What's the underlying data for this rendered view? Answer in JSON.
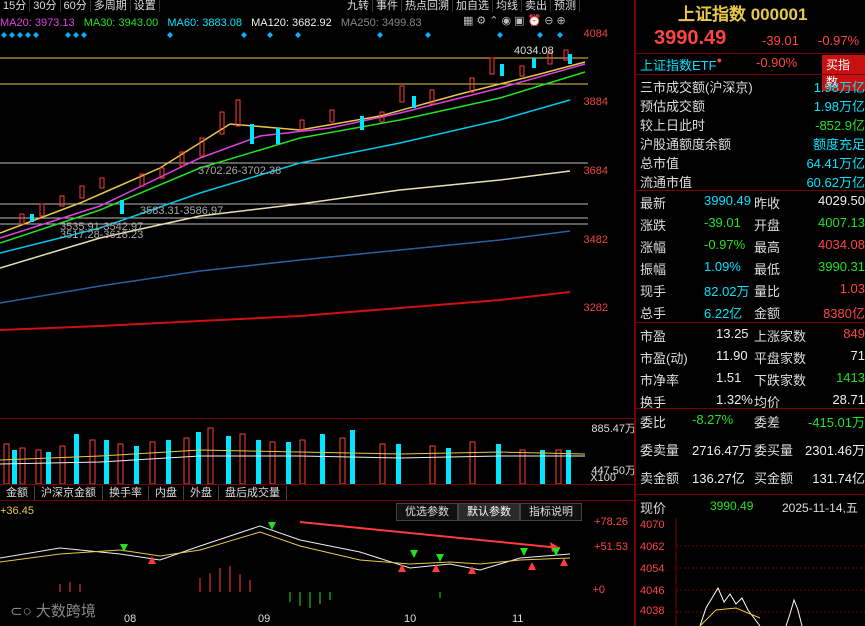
{
  "toolbar": {
    "items": [
      "15分",
      "30分",
      "60分",
      "多周期",
      "设置"
    ],
    "right_items": [
      "九转",
      "事件",
      "热点回溯",
      "加自选",
      "均线",
      "卖出",
      "预测"
    ]
  },
  "ma": {
    "ma20": "MA20: 3973.13",
    "ma30": "MA30: 3943.00",
    "ma60": "MA60: 3883.08",
    "ma120": "MA120: 3682.92",
    "ma250": "MA250: 3499.83"
  },
  "price_axis": [
    "4084",
    "3884",
    "3684",
    "3482",
    "3282"
  ],
  "price_annotations": {
    "high": "4034.08",
    "a1": "3702.26-3702.38",
    "a2": "3583.31-3586.97",
    "a3": "3535.91-3542.97",
    "a4": "3517.28-3618.23"
  },
  "volume_axis": {
    "top": "885.47万",
    "mid": "447.50万",
    "unit": "X100"
  },
  "bottom_tabs": [
    "金额",
    "沪深京金额",
    "换手率",
    "内盘",
    "外盘",
    "盘后成交量"
  ],
  "indicator": {
    "value": "+36.45",
    "tabs": [
      "优选参数",
      "默认参数",
      "指标说明"
    ],
    "axis": [
      "+78.26",
      "+51.53",
      "+0"
    ]
  },
  "x_axis": [
    "08",
    "09",
    "10",
    "11"
  ],
  "watermark": "大数跨境",
  "right": {
    "title": "上证指数 000001",
    "price": "3990.49",
    "change": "-39.01",
    "change_pct": "-0.97%",
    "etf_label": "上证指数ETF",
    "etf_pct": "-0.90%",
    "buy_btn": "买指数",
    "info": [
      {
        "k": "三市成交额(沪深京)",
        "v": "1.98万亿"
      },
      {
        "k": "预估成交额",
        "v": "1.98万亿"
      },
      {
        "k": "较上日此时",
        "v": "-852.9亿"
      },
      {
        "k": "沪股通额度余额",
        "v": "额度充足"
      },
      {
        "k": "总市值",
        "v": "64.41万亿"
      },
      {
        "k": "流通市值",
        "v": "60.62万亿"
      }
    ],
    "quote": [
      {
        "k1": "最新",
        "v1": "3990.49",
        "k2": "昨收",
        "v2": "4029.50"
      },
      {
        "k1": "涨跌",
        "v1": "-39.01",
        "k2": "开盘",
        "v2": "4007.13"
      },
      {
        "k1": "涨幅",
        "v1": "-0.97%",
        "k2": "最高",
        "v2": "4034.08"
      },
      {
        "k1": "振幅",
        "v1": "1.09%",
        "k2": "最低",
        "v2": "3990.31"
      },
      {
        "k1": "现手",
        "v1": "82.02万",
        "k2": "量比",
        "v2": "1.03"
      },
      {
        "k1": "总手",
        "v1": "6.22亿",
        "k2": "金额",
        "v2": "8380亿"
      }
    ],
    "market": [
      {
        "k1": "市盈",
        "v1": "13.25",
        "k2": "上涨家数",
        "v2": "849"
      },
      {
        "k1": "市盈(动)",
        "v1": "11.90",
        "k2": "平盘家数",
        "v2": "71"
      },
      {
        "k1": "市净率",
        "v1": "1.51",
        "k2": "下跌家数",
        "v2": "1413"
      },
      {
        "k1": "换手",
        "v1": "1.32%",
        "k2": "均价",
        "v2": "28.71"
      }
    ],
    "orders": [
      {
        "k1": "委比",
        "v1": "-8.27%",
        "k2": "委差",
        "v2": "-415.01万"
      },
      {
        "k1": "委卖量",
        "v1": "2716.47万",
        "k2": "委买量",
        "v2": "2301.46万"
      },
      {
        "k1": "卖金额",
        "v1": "136.27亿",
        "k2": "买金额",
        "v2": "131.74亿"
      }
    ],
    "now_label": "现价",
    "now_price": "3990.49",
    "date": "2025-11-14,五",
    "mini_axis": [
      "4070",
      "4062",
      "4054",
      "4046",
      "4038"
    ]
  },
  "colors": {
    "up": "#ff4444",
    "down": "#22e022",
    "cyan": "#00e5ff",
    "gold": "#e8c84a",
    "border": "#7a0000"
  }
}
